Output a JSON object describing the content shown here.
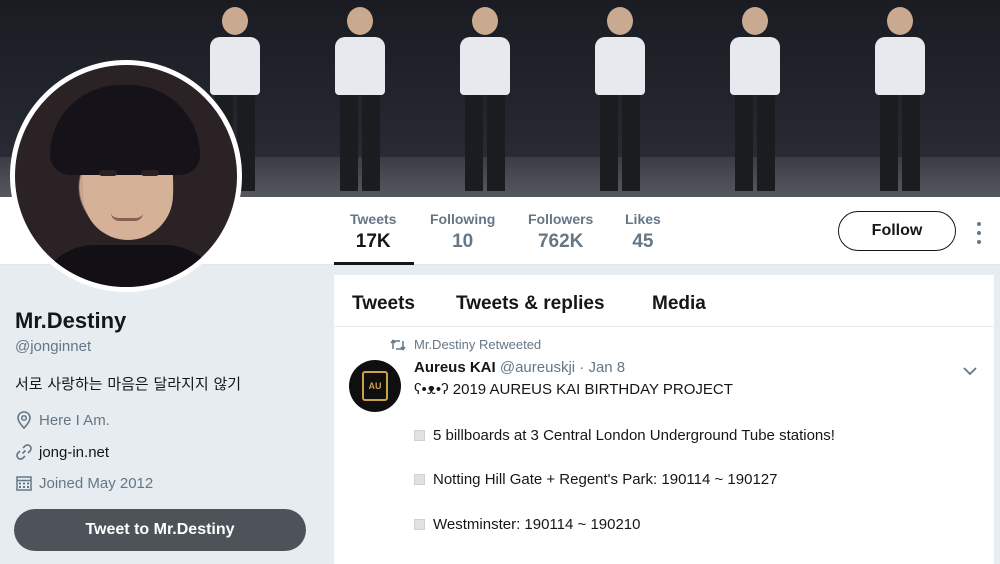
{
  "profile": {
    "name": "Mr.Destiny",
    "handle": "@jonginnet",
    "bio": "서로 사랑하는 마음은 달라지지 않기",
    "location": "Here I Am.",
    "website": "jong-in.net",
    "joined": "Joined May 2012",
    "tweet_to_label": "Tweet to Mr.Destiny"
  },
  "stats": [
    {
      "label": "Tweets",
      "value": "17K"
    },
    {
      "label": "Following",
      "value": "10"
    },
    {
      "label": "Followers",
      "value": "762K"
    },
    {
      "label": "Likes",
      "value": "45"
    }
  ],
  "follow_label": "Follow",
  "tabs": [
    "Tweets",
    "Tweets & replies",
    "Media"
  ],
  "tweet": {
    "retweet_label": "Mr.Destiny Retweeted",
    "author_name": "Aureus KAI",
    "author_handle": "@aureuskji",
    "date": "· Jan 8",
    "avatar_text": "AU",
    "lines": [
      "ʕ•ᴥ•ʔ 2019 AUREUS KAI BIRTHDAY PROJECT",
      "5 billboards at 3 Central London Underground Tube stations!",
      "Notting Hill Gate + Regent's Park: 190114 ~ 190127",
      "Westminster: 190114 ~ 190210"
    ]
  },
  "colors": {
    "accent_dark": "#14171a",
    "muted": "#657786",
    "page_bg": "#e6ecf0"
  },
  "icons": [
    "location-pin-icon",
    "link-icon",
    "calendar-icon",
    "retweet-icon",
    "chevron-down-icon",
    "more-dots-icon"
  ]
}
